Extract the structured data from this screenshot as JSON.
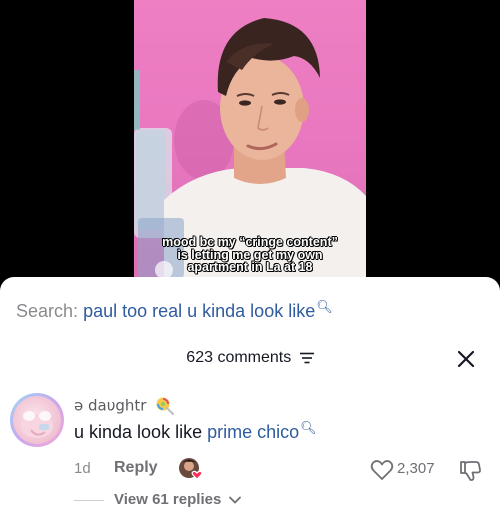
{
  "video": {
    "caption_lines": [
      "mood bc my “cringe content”",
      "is letting me get my own",
      "apartment in La at 18"
    ]
  },
  "search": {
    "prefix": "Search:",
    "query": "paul too real u kinda look like",
    "icon": "magnifier-icon"
  },
  "comments_header": {
    "count_label": "623 comments",
    "filter_icon": "filter-icon",
    "close_icon": "close-icon"
  },
  "comment": {
    "username": "ə daυghtr",
    "badge_icon": "lollipop-icon",
    "text": "u kinda look like ",
    "link_text": "prime chico",
    "time": "1d",
    "reply_label": "Reply",
    "like_count": "2,307",
    "view_replies": "View 61 replies"
  },
  "colors": {
    "link": "#2f5c9f",
    "muted": "#8a8a8e",
    "text": "#161823",
    "video_bg": "#e978c0"
  }
}
